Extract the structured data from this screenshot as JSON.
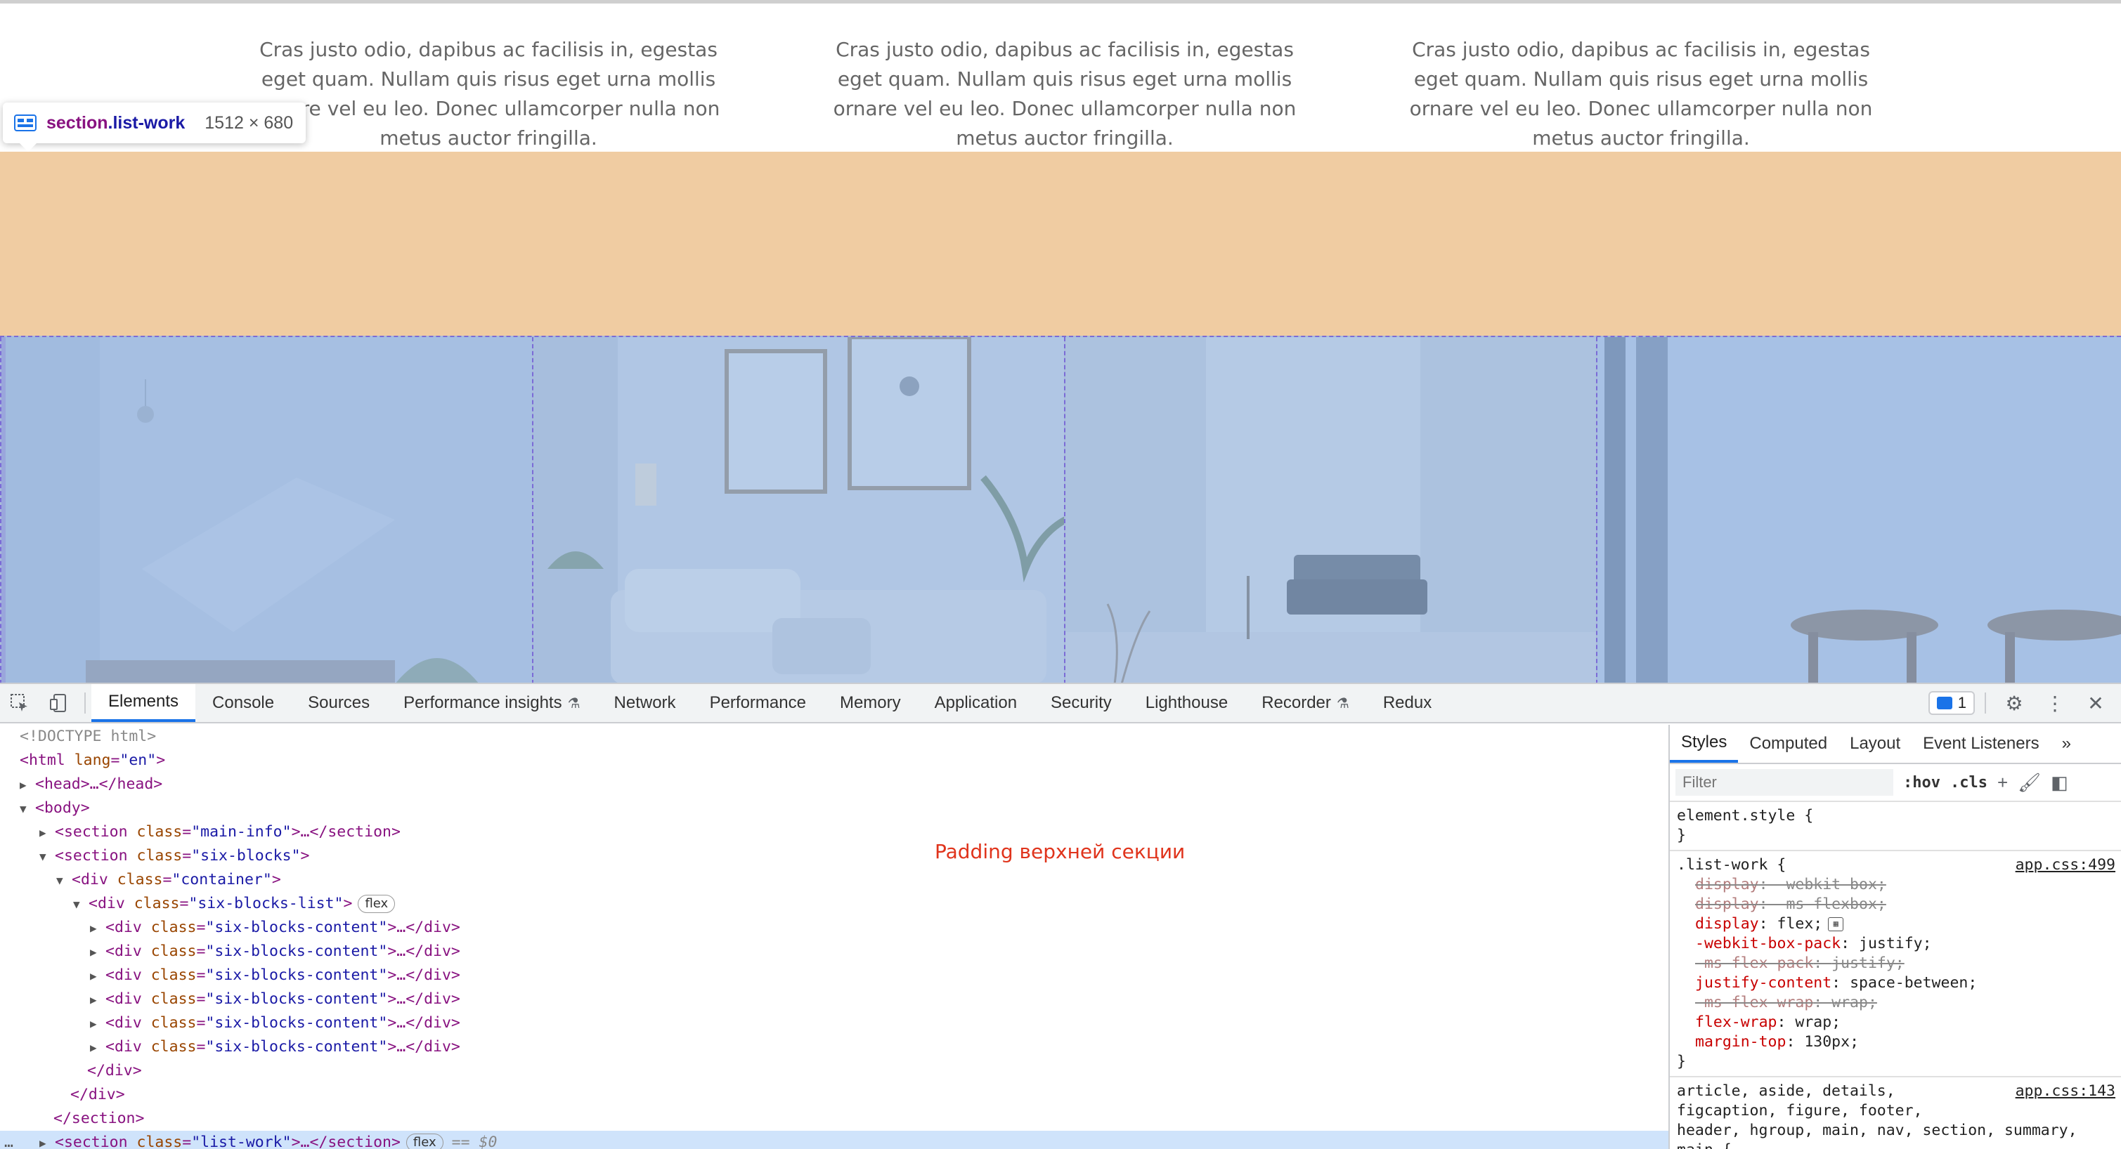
{
  "viewport": {
    "columns": [
      "Cras justo odio, dapibus ac facilisis in, egestas eget quam. Nullam quis risus eget urna mollis ornare vel eu leo. Donec ullamcorper nulla non metus auctor fringilla.",
      "Cras justo odio, dapibus ac facilisis in, egestas eget quam. Nullam quis risus eget urna mollis ornare vel eu leo. Donec ullamcorper nulla non metus auctor fringilla.",
      "Cras justo odio, dapibus ac facilisis in, egestas eget quam. Nullam quis risus eget urna mollis ornare vel eu leo. Donec ullamcorper nulla non metus auctor fringilla."
    ],
    "tooltip": {
      "tag": "section",
      "cls": ".list-work",
      "dimensions": "1512 × 680"
    },
    "colors": {
      "margin_highlight": "#f0cca2",
      "content_highlight": "#a9bdd9"
    }
  },
  "devtools": {
    "tabs": [
      "Elements",
      "Console",
      "Sources",
      "Performance insights",
      "Network",
      "Performance",
      "Memory",
      "Application",
      "Security",
      "Lighthouse",
      "Recorder",
      "Redux"
    ],
    "active_tab": "Elements",
    "issues_count": "1",
    "dom": {
      "doctype": "<!DOCTYPE html>",
      "html_open": "<html",
      "html_attr": "lang",
      "html_val": "\"en\"",
      "head": "<head>…</head>",
      "body": "<body>",
      "section1_val": "\"main-info\"",
      "section2_val": "\"six-blocks\"",
      "container_val": "\"container\"",
      "list_val": "\"six-blocks-list\"",
      "content_val": "\"six-blocks-content\"",
      "div_close": "</div>",
      "section_close": "</section>",
      "listwork_val": "\"list-work\"",
      "flex_badge": "flex",
      "selected_marker": "== $0",
      "more_dots": "…"
    },
    "annotation": "Padding верхней секции",
    "styles": {
      "tabs": [
        "Styles",
        "Computed",
        "Layout",
        "Event Listeners"
      ],
      "filter_placeholder": "Filter",
      "hov": ":hov",
      "cls": ".cls",
      "element_style": "element.style {",
      "close_brace": "}",
      "selector": ".list-work {",
      "source1": "app.css:499",
      "props": [
        {
          "name": "display",
          "value": "-webkit-box;",
          "struck": true
        },
        {
          "name": "display",
          "value": "-ms-flexbox;",
          "struck": true
        },
        {
          "name": "display",
          "value": "flex;",
          "struck": false
        },
        {
          "name": "-webkit-box-pack",
          "value": "justify;",
          "struck": false
        },
        {
          "name": "-ms-flex-pack",
          "value": "justify;",
          "struck": true
        },
        {
          "name": "justify-content",
          "value": "space-between;",
          "struck": false
        },
        {
          "name": "-ms-flex-wrap",
          "value": "wrap;",
          "struck": true
        },
        {
          "name": "flex-wrap",
          "value": "wrap;",
          "struck": false
        },
        {
          "name": "margin-top",
          "value": "130px;",
          "struck": false
        }
      ],
      "source2": "app.css:143",
      "selector2_lines": [
        "article, aside, details,",
        "figcaption, figure, footer,",
        "header, hgroup, main, nav, section, summary,",
        "main {"
      ]
    }
  }
}
